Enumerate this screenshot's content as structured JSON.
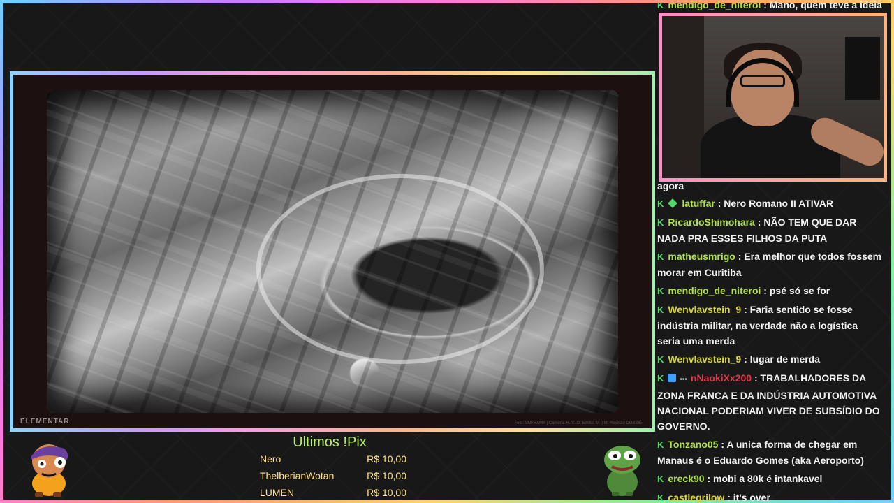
{
  "screen": {
    "watermark": "ELEMENTAR",
    "caption": "Foto: SUFRAMA | Camera: H. S. O. Emilio, M. | M. Revisão DOSSIÊ"
  },
  "pix": {
    "title": "Ultimos !Pix",
    "rows": [
      {
        "name": "Nero",
        "amount": "R$ 10,00"
      },
      {
        "name": "ThelberianWotan",
        "amount": "R$ 10,00"
      },
      {
        "name": "LUMEN",
        "amount": "R$ 10,00"
      }
    ]
  },
  "chat": {
    "top": {
      "user": "mendigo_de_niteroi",
      "text": "Mano, quem teve a ideia"
    },
    "agora": "agora",
    "messages": [
      {
        "user": "latuffar",
        "text": "Nero Romano II ATIVAR",
        "badges": "k-sub",
        "color": "#aee04a"
      },
      {
        "user": "RicardoShimohara",
        "text": "NÃO TEM QUE DAR NADA PRA ESSES FILHOS DA PUTA",
        "badges": "k",
        "color": "#aee04a"
      },
      {
        "user": "matheusmrigo",
        "text": "Era melhor que todos fossem morar em Curitiba",
        "badges": "k",
        "color": "#aee04a"
      },
      {
        "user": "mendigo_de_niteroi",
        "text": "psé só se for",
        "badges": "k",
        "color": "#aee04a"
      },
      {
        "user": "Wenvlavstein_9",
        "text": "Faria sentido se fosse indústria militar, na verdade não a logística seria uma merda",
        "badges": "k",
        "color": "#d9d63a"
      },
      {
        "user": "Wenvlavstein_9",
        "text": "lugar de merda",
        "badges": "k",
        "color": "#d9d63a"
      },
      {
        "user": "nNaokiXx200",
        "text": "TRABALHADORES DA ZONA FRANCA E DA INDÚSTRIA AUTOMOTIVA NACIONAL PODERIAM VIVER DE SUBSÍDIO DO GOVERNO.",
        "badges": "k-cube-dots",
        "color": "#e23a4a"
      },
      {
        "user": "Tonzano05",
        "text": "A unica forma de chegar em Manaus é o Eduardo Gomes (aka Aeroporto)",
        "badges": "k",
        "color": "#aee04a"
      },
      {
        "user": "ereck90",
        "text": "mobi a 80k é intankavel",
        "badges": "k",
        "color": "#aee04a"
      },
      {
        "user": "castlegrilow",
        "text": "it's over",
        "badges": "k",
        "color": "#d9d63a"
      }
    ]
  },
  "colors": {
    "accent_green": "#53d769",
    "pix_title": "#b8ef6a",
    "pix_text": "#ffe08a"
  }
}
